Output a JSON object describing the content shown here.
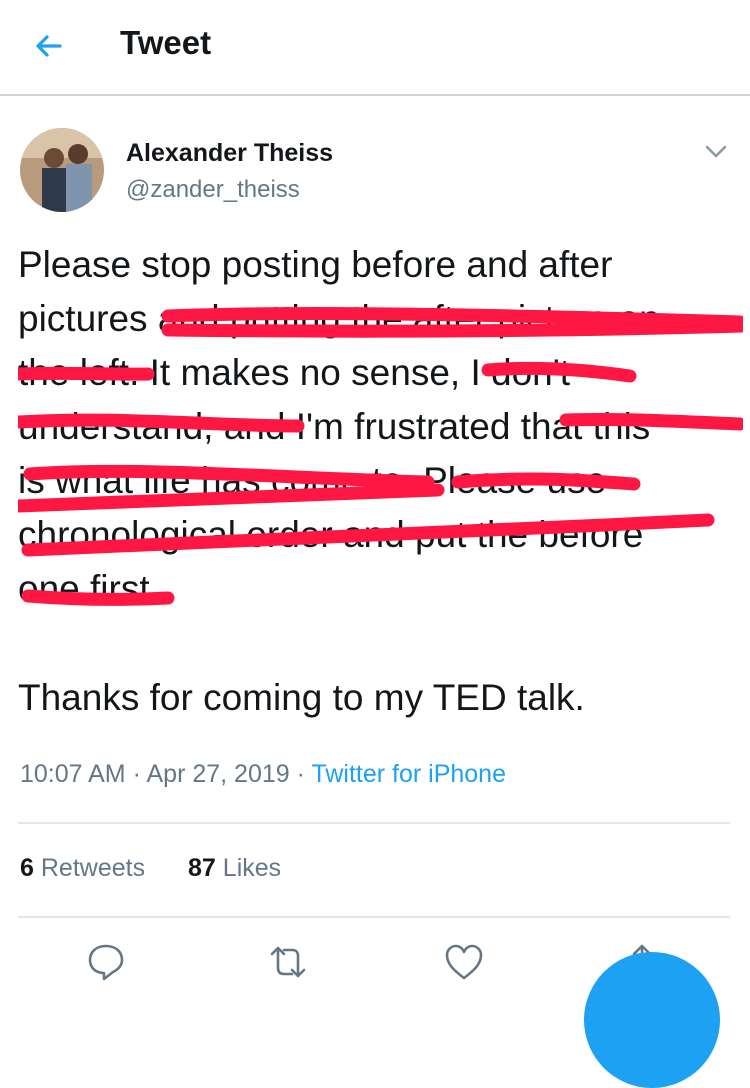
{
  "header": {
    "title": "Tweet",
    "back_icon": "arrow-left-icon"
  },
  "author": {
    "name": "Alexander Theiss",
    "handle": "@zander_theiss"
  },
  "tweet": {
    "lines": [
      "Please stop posting before and after",
      "pictures and putting the after picture on",
      "the left. It makes no sense, I don't",
      "understand, and I'm frustrated that this",
      "is what life has come to. Please use",
      "chronological order and put the before",
      "one first."
    ],
    "closing": "Thanks for coming to my TED talk."
  },
  "meta": {
    "time": "10:07 AM",
    "date": "Apr 27, 2019",
    "source": "Twitter for iPhone"
  },
  "stats": {
    "retweets_count": "6",
    "retweets_label": "Retweets",
    "likes_count": "87",
    "likes_label": "Likes"
  },
  "actions": [
    "reply-icon",
    "retweet-icon",
    "like-icon",
    "share-icon"
  ],
  "colors": {
    "accent": "#1da1f2",
    "scribble": "#ff1744",
    "secondary_text": "#657786"
  }
}
